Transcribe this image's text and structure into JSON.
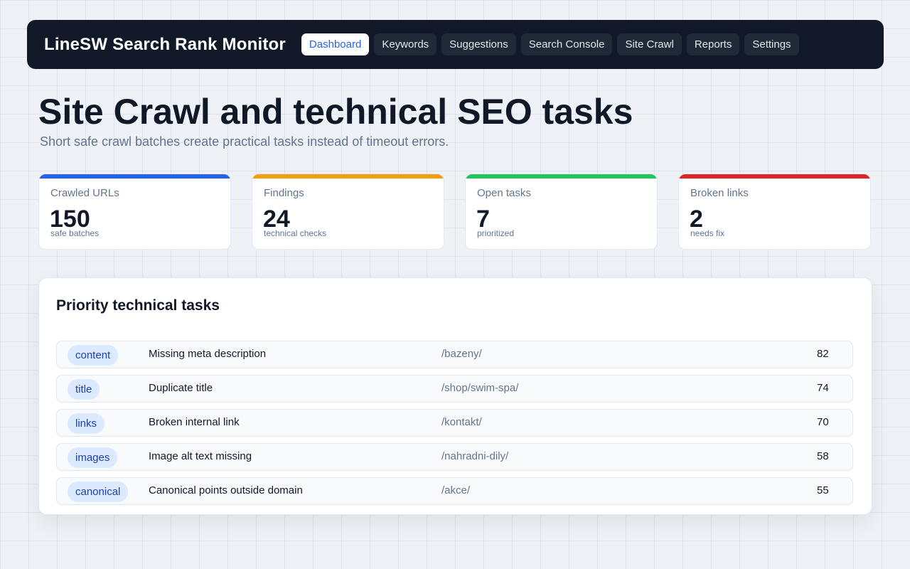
{
  "app": {
    "title": "LineSW Search Rank Monitor"
  },
  "nav": {
    "items": [
      {
        "label": "Dashboard",
        "active": true
      },
      {
        "label": "Keywords"
      },
      {
        "label": "Suggestions"
      },
      {
        "label": "Search Console"
      },
      {
        "label": "Site Crawl"
      },
      {
        "label": "Reports"
      },
      {
        "label": "Settings"
      }
    ]
  },
  "header": {
    "title": "Site Crawl and technical SEO tasks",
    "subtitle": "Short safe crawl batches create practical tasks instead of timeout errors."
  },
  "stats": [
    {
      "label": "Crawled URLs",
      "value": "150",
      "sub": "safe batches",
      "color": "#2563eb"
    },
    {
      "label": "Findings",
      "value": "24",
      "sub": "technical checks",
      "color": "#f59e0b"
    },
    {
      "label": "Open tasks",
      "value": "7",
      "sub": "prioritized",
      "color": "#22c55e"
    },
    {
      "label": "Broken links",
      "value": "2",
      "sub": "needs fix",
      "color": "#dc2626"
    }
  ],
  "tasks": {
    "title": "Priority technical tasks",
    "rows": [
      {
        "tag": "content",
        "title": "Missing meta description",
        "path": "/bazeny/",
        "score": "82"
      },
      {
        "tag": "title",
        "title": "Duplicate title",
        "path": "/shop/swim-spa/",
        "score": "74"
      },
      {
        "tag": "links",
        "title": "Broken internal link",
        "path": "/kontakt/",
        "score": "70"
      },
      {
        "tag": "images",
        "title": "Image alt text missing",
        "path": "/nahradni-dily/",
        "score": "58"
      },
      {
        "tag": "canonical",
        "title": "Canonical points outside domain",
        "path": "/akce/",
        "score": "55"
      }
    ]
  },
  "colors": {
    "nav_bg": "#111827",
    "accent": "#2563eb",
    "tag_bg": "#dbeafe",
    "tag_text": "#1e40af"
  }
}
